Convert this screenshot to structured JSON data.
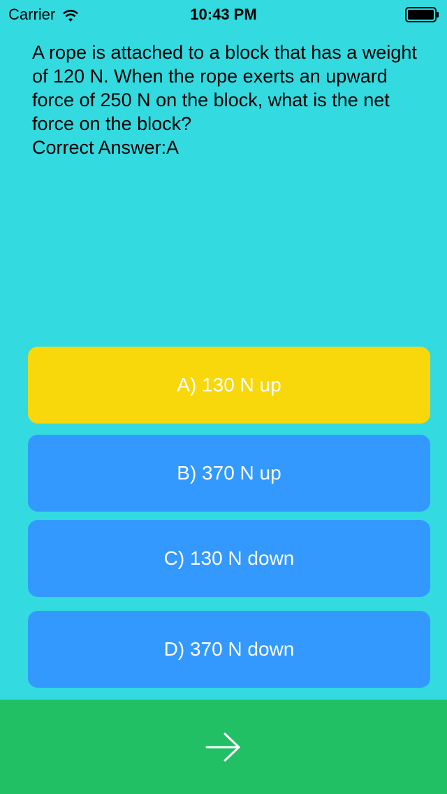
{
  "status_bar": {
    "carrier": "Carrier",
    "time": "10:43 PM"
  },
  "question": {
    "text": "A rope is attached to a block that has a weight of 120 N. When the rope exerts an upward force of 250 N on the block, what is the net force on the block?",
    "correct_answer_label": "Correct Answer:A"
  },
  "options": [
    {
      "label": "A) 130 N up",
      "color": "#f8d80a",
      "state": "highlighted"
    },
    {
      "label": "B) 370 N up",
      "color": "#3399ff",
      "state": "default"
    },
    {
      "label": "C) 130 N down",
      "color": "#3399ff",
      "state": "default"
    },
    {
      "label": "D) 370 N down",
      "color": "#3399ff",
      "state": "default"
    }
  ],
  "footer": {
    "next_icon": "arrow-right-icon",
    "color": "#22c064"
  },
  "colors": {
    "background": "#33dae0"
  }
}
